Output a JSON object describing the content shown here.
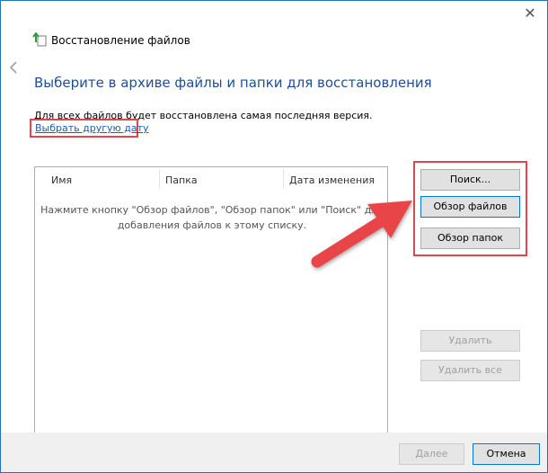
{
  "window": {
    "title": "Восстановление файлов"
  },
  "page": {
    "heading": "Выберите в архиве файлы и папки для восстановления",
    "info": "Для всех файлов будет восстановлена самая последняя версия.",
    "date_link": "Выбрать другую дату"
  },
  "list": {
    "columns": [
      "Имя",
      "Папка",
      "Дата изменения"
    ],
    "empty_line1": "Нажмите кнопку \"Обзор файлов\", \"Обзор папок\" или \"Поиск\" для",
    "empty_line2": "добавления файлов к этому списку."
  },
  "buttons": {
    "search": "Поиск...",
    "browse_files": "Обзор файлов",
    "browse_folders": "Обзор папок",
    "remove": "Удалить",
    "remove_all": "Удалить все",
    "next": "Далее",
    "cancel": "Отмена"
  },
  "colors": {
    "heading": "#1e4e9a",
    "link": "#1a5fb4",
    "highlight": "#e0464d",
    "focus": "#0078d7"
  },
  "icons": {
    "close": "close-icon",
    "back": "back-arrow-icon",
    "app": "file-restore-icon",
    "annotation_arrow": "red-arrow-icon"
  }
}
